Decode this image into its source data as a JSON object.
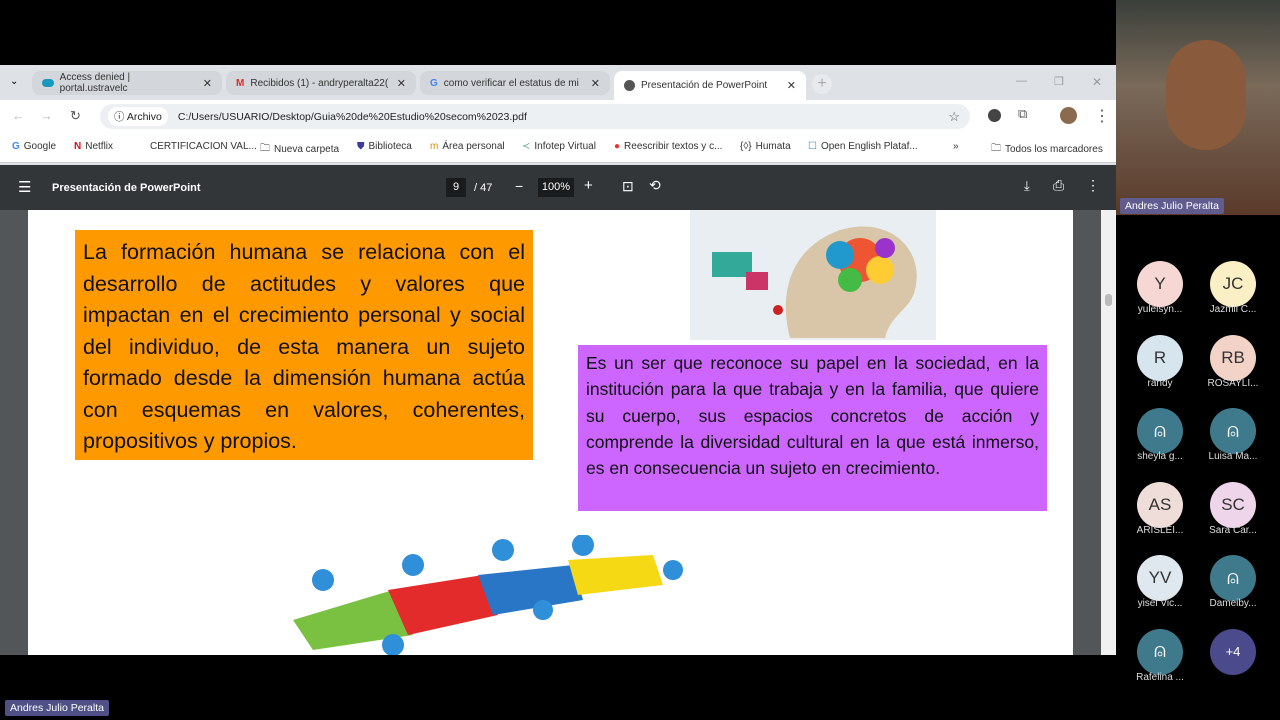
{
  "browser": {
    "tabs": [
      {
        "label": "Access denied | portal.ustravelc",
        "icon": "salesforce-icon"
      },
      {
        "label": "Recibidos (1) - andryperalta22(",
        "icon": "gmail-icon"
      },
      {
        "label": "como verificar el estatus de mi",
        "icon": "google-icon"
      },
      {
        "label": "Presentación de PowerPoint",
        "icon": "globe-icon",
        "active": true
      }
    ],
    "address": {
      "security_label": "Archivo",
      "url": "C:/Users/USUARIO/Desktop/Guia%20de%20Estudio%20secom%2023.pdf"
    },
    "bookmarks": [
      "Google",
      "Netflix",
      "CERTIFICACION VAL...",
      "Nueva carpeta",
      "Biblioteca",
      "Área personal",
      "Infotep Virtual",
      "Reescribir textos y c...",
      "Humata",
      "Open English Plataf..."
    ],
    "overflow": "»",
    "all_bookmarks": "Todos los marcadores"
  },
  "pdf": {
    "title": "Presentación de PowerPoint",
    "page_current": "9",
    "page_total": "/ 47",
    "zoom": "100%",
    "orange_text": "La formación humana se relaciona con el desarrollo de actitudes y valores que impactan en el crecimiento personal y social del individuo, de esta manera un sujeto formado desde la dimensión humana actúa con esquemas en valores, coherentes, propositivos y propios.",
    "purple_text": "Es un ser que reconoce su papel en la sociedad, en la institución para la que trabaja y en la familia, que quiere su cuerpo, sus espacios concretos de acción y comprende la diversidad cultural en la que está inmerso, es en consecuencia un sujeto en crecimiento.",
    "colors": {
      "orange": "#ff9900",
      "purple": "#cc66ff"
    }
  },
  "meeting": {
    "presenter": "Andres Julio Peralta",
    "self_label": "Andres Julio Peralta",
    "participants": [
      {
        "initials": "Y",
        "name": "yuleisyn...",
        "color": "#f6d7d3"
      },
      {
        "initials": "JC",
        "name": "Jazmil C...",
        "color": "#fbefc5"
      },
      {
        "initials": "R",
        "name": "randy",
        "color": "#d6e5ee"
      },
      {
        "initials": "RB",
        "name": "ROSAYLI...",
        "color": "#f3d3c8"
      },
      {
        "initials": "",
        "name": "sheyla g...",
        "color": "#3f7a8c"
      },
      {
        "initials": "",
        "name": "Luisa Ma...",
        "color": "#3f7a8c"
      },
      {
        "initials": "AS",
        "name": "ARISLEI...",
        "color": "#eeddd8"
      },
      {
        "initials": "SC",
        "name": "Sara Car...",
        "color": "#eed5ea"
      },
      {
        "initials": "YV",
        "name": "yisel Vic...",
        "color": "#dfe8ef"
      },
      {
        "initials": "",
        "name": "Dameiby...",
        "color": "#3f7a8c"
      },
      {
        "initials": "",
        "name": "Rafelina ...",
        "color": "#3f7a8c"
      }
    ],
    "more": "+4"
  }
}
